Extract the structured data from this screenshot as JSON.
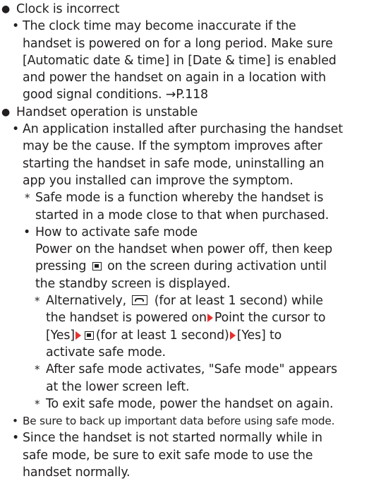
{
  "icons": {
    "bullet_main": "●",
    "bullet_sub": "•",
    "note": "*",
    "center_key": "center-key-icon",
    "end_key": "end-call-key-icon",
    "step_arrow": "red-step-arrow-icon",
    "step_arrow_color": "#e8312e"
  },
  "sections": [
    {
      "heading": "Clock is incorrect",
      "lines": [
        "The clock time may become inaccurate if the",
        "handset is powered on for a long period. Make sure",
        "[Automatic date & time] in [Date & time] is enabled",
        "and power the handset on again in a location with",
        "good signal conditions. →P.118"
      ]
    },
    {
      "heading": "Handset operation is unstable",
      "cause_lines": [
        "An application installed after purchasing the handset",
        "may be the cause. If the symptom improves after",
        "starting the handset in safe mode, uninstalling an",
        "app you installed can improve the symptom."
      ],
      "note_safe_mode": [
        "Safe mode is a function whereby the handset is",
        "started in a mode close to that when purchased."
      ],
      "howto_title": "How to activate safe mode",
      "howto_lines": [
        "Power on the handset when power off, then keep",
        "pressing",
        "on the screen during activation until",
        "the standby screen is displayed."
      ],
      "alt_note": {
        "l1_a": "Alternatively,",
        "l1_b": "(for at least 1 second) while",
        "l2_a": "the handset is powered on",
        "l2_b": "Point the cursor to",
        "l3_a": "[Yes]",
        "l3_b": "(for at least 1 second)",
        "l3_c": "[Yes] to",
        "l4": "activate safe mode."
      },
      "after_note": [
        "After safe mode activates, \"Safe mode\" appears",
        "at the lower screen left."
      ],
      "exit_note": "To exit safe mode, power the handset on again.",
      "backup_line": "Be sure to back up important data before using safe mode.",
      "since_lines": [
        "Since the handset is not started normally while in",
        "safe mode, be sure to exit safe mode to use the",
        "handset normally."
      ]
    }
  ]
}
